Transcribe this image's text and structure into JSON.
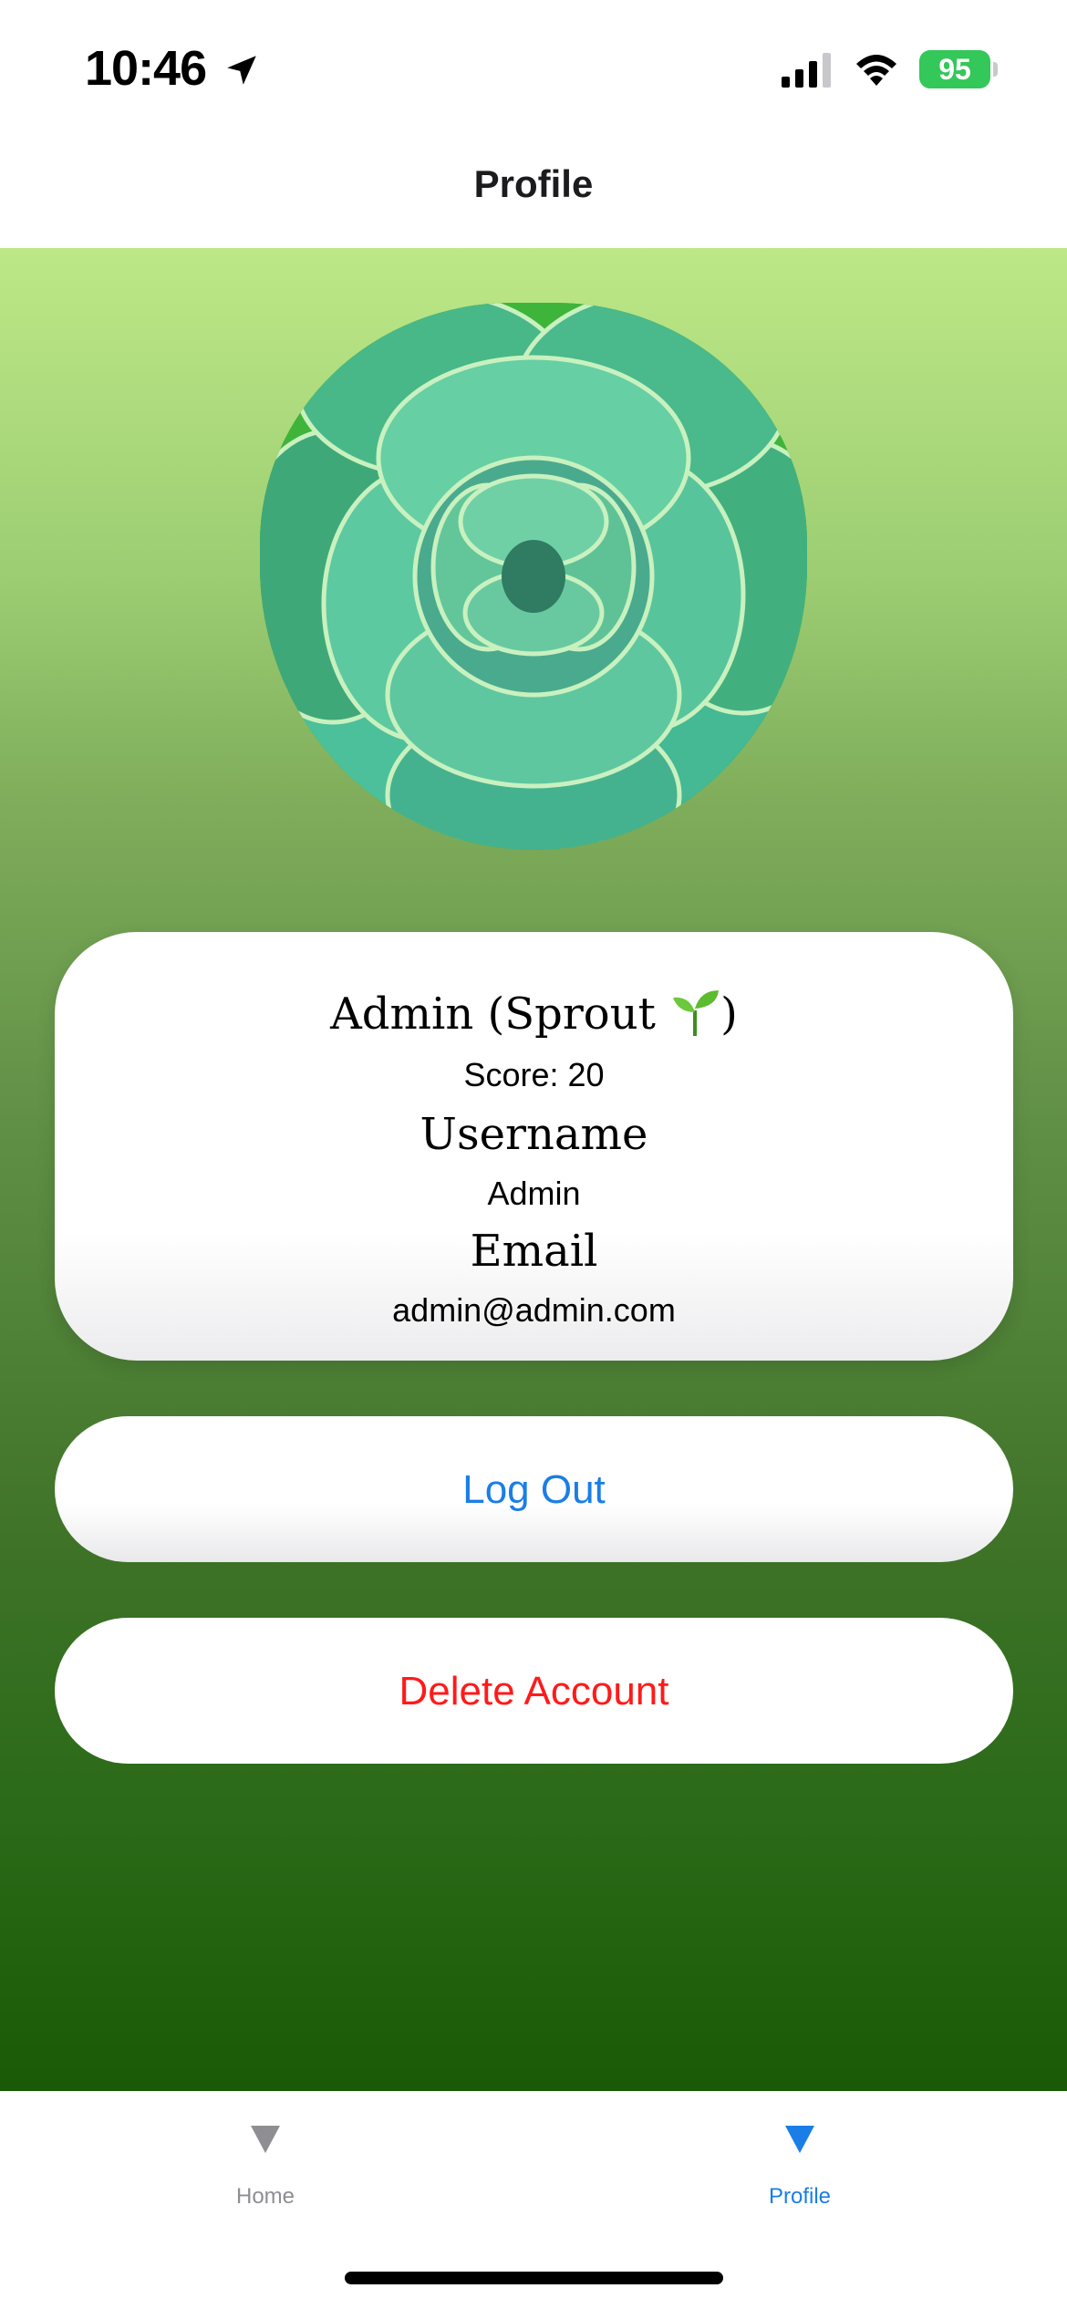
{
  "status_bar": {
    "time": "10:46",
    "battery": "95",
    "icons": [
      "location-arrow-icon",
      "cellular-signal-icon",
      "wifi-icon",
      "battery-charging-icon"
    ]
  },
  "nav": {
    "title": "Profile"
  },
  "profile": {
    "name_line": "Admin (Sprout ",
    "name_close": ")",
    "score": "Score: 20",
    "username_heading": "Username",
    "username_value": "Admin",
    "email_heading": "Email",
    "email_value": "admin@admin.com"
  },
  "actions": {
    "logout_label": "Log Out",
    "delete_label": "Delete Account"
  },
  "tabbar": {
    "items": [
      {
        "label": "Home",
        "icon": "triangle-down-icon",
        "selected": false
      },
      {
        "label": "Profile",
        "icon": "triangle-down-icon",
        "selected": true
      }
    ]
  },
  "colors": {
    "accent": "#1a7ee6",
    "destructive": "#ff1a1a",
    "battery": "#34c759",
    "gradient_top": "#bde887",
    "gradient_bottom": "#1a5a06"
  }
}
